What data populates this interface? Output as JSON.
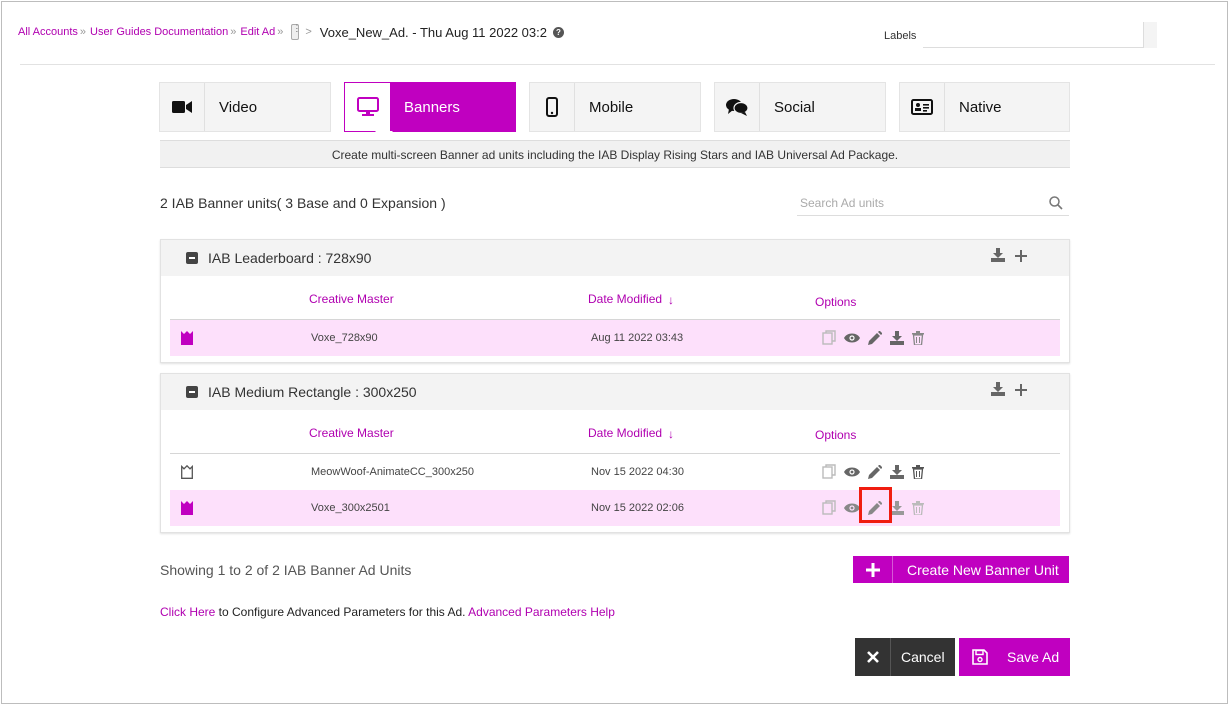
{
  "breadcrumb": {
    "items": [
      "All Accounts",
      "User Guides Documentation",
      "Edit Ad"
    ],
    "separator": "»",
    "more": "⋮",
    "arrow": ">",
    "current": "Voxe_New_Ad.  - Thu Aug 11 2022 03:2",
    "help": "?"
  },
  "labels": {
    "label": "Labels",
    "value": ""
  },
  "tabs": [
    {
      "label": "Video",
      "icon": "video-camera-icon",
      "active": false
    },
    {
      "label": "Banners",
      "icon": "monitor-icon",
      "active": true
    },
    {
      "label": "Mobile",
      "icon": "mobile-phone-icon",
      "active": false
    },
    {
      "label": "Social",
      "icon": "chat-bubbles-icon",
      "active": false
    },
    {
      "label": "Native",
      "icon": "id-card-icon",
      "active": false
    }
  ],
  "tab_description": "Create multi-screen Banner ad units including the IAB Display Rising Stars and IAB Universal Ad Package.",
  "unit_count": "2 IAB Banner units( 3 Base and 0 Expansion )",
  "search": {
    "placeholder": "Search Ad units",
    "value": ""
  },
  "columns": {
    "creative": "Creative Master",
    "date": "Date Modified",
    "sort": "↓",
    "options": "Options"
  },
  "groups": [
    {
      "title": "IAB Leaderboard : 728x90",
      "rows": [
        {
          "name": "Voxe_728x90",
          "date": "Aug 11 2022 03:43",
          "highlighted": true
        }
      ]
    },
    {
      "title": "IAB Medium Rectangle : 300x250",
      "rows": [
        {
          "name": "MeowWoof-AnimateCC_300x250",
          "date": "Nov 15 2022 04:30",
          "highlighted": false
        },
        {
          "name": "Voxe_300x2501",
          "date": "Nov 15 2022 02:06",
          "highlighted": true
        }
      ]
    }
  ],
  "showing": "Showing 1 to 2 of 2 IAB Banner Ad Units",
  "create_button": {
    "icon": "+",
    "label": "Create New Banner Unit"
  },
  "advanced": {
    "link": "Click Here",
    "text": " to Configure Advanced Parameters for this Ad. ",
    "help_link": "Advanced Parameters Help"
  },
  "cancel_button": {
    "icon": "✕",
    "label": "Cancel"
  },
  "save_button": {
    "label": "Save Ad"
  },
  "colors": {
    "accent": "#c000c0",
    "highlight_row": "#fde0fb",
    "focus_box": "#f01d10",
    "dark_button": "#333333"
  }
}
